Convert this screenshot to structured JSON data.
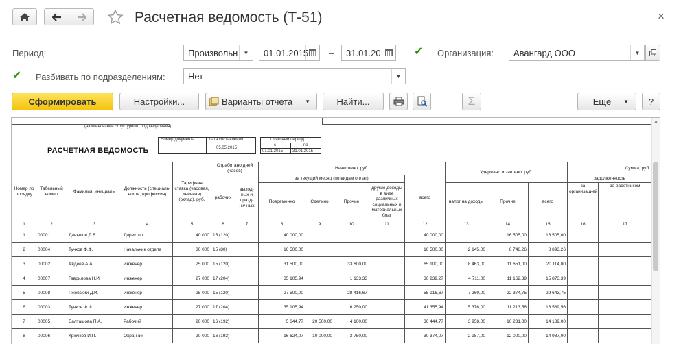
{
  "window": {
    "title": "Расчетная ведомость (Т-51)",
    "close": "×"
  },
  "filters": {
    "period_label": "Период:",
    "period_mode": "Произвольн",
    "date_from": "01.01.2015",
    "date_sep": "–",
    "date_to": "31.01.20",
    "org_label": "Организация:",
    "org_value": "Авангард ООО",
    "split_label": "Разбивать по подразделениям:",
    "split_value": "Нет"
  },
  "toolbar": {
    "generate": "Сформировать",
    "settings": "Настройки...",
    "variants": "Варианты отчета",
    "find": "Найти...",
    "sum": "Σ",
    "more": "Еще",
    "help": "?"
  },
  "report": {
    "dept_caption": "(наименование структурного подразделения)",
    "title": "РАСЧЕТНАЯ ВЕДОМОСТЬ",
    "doc_number_label": "Номер документа",
    "doc_date_label": "Дата составления",
    "doc_date": "05.05.2015",
    "period_label": "Отчетный период",
    "period_from_label": "с",
    "period_to_label": "по",
    "period_from": "01.01.2015",
    "period_to": "31.01.2015",
    "headers": {
      "num": "Номер по поряд­ку",
      "tab": "Табельный номер",
      "fio": "Фамилия, инициалы",
      "pos": "Должность (специаль­ность, профессия)",
      "rate": "Тарифная ставка (часовая, дневная) (оклад), руб.",
      "worked": "Отработано дней (часов)",
      "work_days": "рабочих",
      "days_off": "выход­ных и празд­ничных",
      "accrued": "Начислено, руб.",
      "accrued_sub": "за текущий месяц (по видам оплат)",
      "timebased": "Повременно",
      "piece": "Сдельно",
      "other": "Прочие",
      "other_income": "другие доходы в виде различных социальных и матери­альных благ",
      "total": "всего",
      "withheld": "Удержано и зачтено, руб.",
      "tax": "налог на доходы",
      "w_other": "Прочие",
      "w_total": "всего",
      "sum": "Сумма, руб.",
      "debt": "задолженность",
      "debt_org": "за организацией",
      "debt_emp": "за работником"
    },
    "col_numbers": [
      "1",
      "2",
      "3",
      "4",
      "5",
      "6",
      "7",
      "8",
      "9",
      "10",
      "11",
      "12",
      "13",
      "14",
      "15",
      "16",
      "17"
    ],
    "rows": [
      [
        "1",
        "00001",
        "Давыдов Д.В.",
        "Директор",
        "40 000",
        "15 (120)",
        "",
        "40 000,00",
        "",
        "",
        "",
        "40 000,00",
        "",
        "16 505,00",
        "16 505,00",
        "",
        ""
      ],
      [
        "2",
        "00004",
        "Тучков Ф.Ф.",
        "Начальник отдела",
        "30 000",
        "15 (80)",
        "",
        "16 500,00",
        "",
        "",
        "",
        "16 500,00",
        "2 145,00",
        "6 748,26",
        "8 893,26",
        "",
        ""
      ],
      [
        "3",
        "00002",
        "Авдеев А.А.",
        "Инженер",
        "25 000",
        "15 (120)",
        "",
        "31 500,00",
        "",
        "33 600,00",
        "",
        "65 100,00",
        "8 463,00",
        "11 651,00",
        "20 114,00",
        "",
        ""
      ],
      [
        "4",
        "00007",
        "Гаврилова Н.И.",
        "Инженер",
        "27 000",
        "17 (204)",
        "",
        "35 105,94",
        "",
        "1 133,33",
        "",
        "36 239,27",
        "4 711,00",
        "11 162,39",
        "15 873,39",
        "",
        ""
      ],
      [
        "5",
        "00008",
        "Ржевский Д.И.",
        "Инженер",
        "25 000",
        "15 (120)",
        "",
        "27 500,00",
        "",
        "28 416,67",
        "",
        "55 916,67",
        "7 269,00",
        "22 374,75",
        "29 643,75",
        "",
        ""
      ],
      [
        "6",
        "00003",
        "Тучков Ф.Ф.",
        "Инженер",
        "27 000",
        "17 (204)",
        "",
        "35 105,94",
        "",
        "6 250,00",
        "",
        "41 355,94",
        "5 376,00",
        "11 213,56",
        "16 589,56",
        "",
        ""
      ],
      [
        "7",
        "00005",
        "Балташова П.А.",
        "Рабочий",
        "20 000",
        "16 (192)",
        "",
        "5 644,77",
        "20 500,00",
        "4 100,00",
        "",
        "30 444,77",
        "3 958,00",
        "10 231,00",
        "14 189,00",
        "",
        ""
      ],
      [
        "8",
        "00006",
        "Крючков И.П.",
        "Охранник",
        "20 000",
        "16 (192)",
        "",
        "16 624,07",
        "10 000,00",
        "3 750,00",
        "",
        "30 374,07",
        "2 987,00",
        "12 000,00",
        "14 987,00",
        "",
        ""
      ]
    ]
  }
}
